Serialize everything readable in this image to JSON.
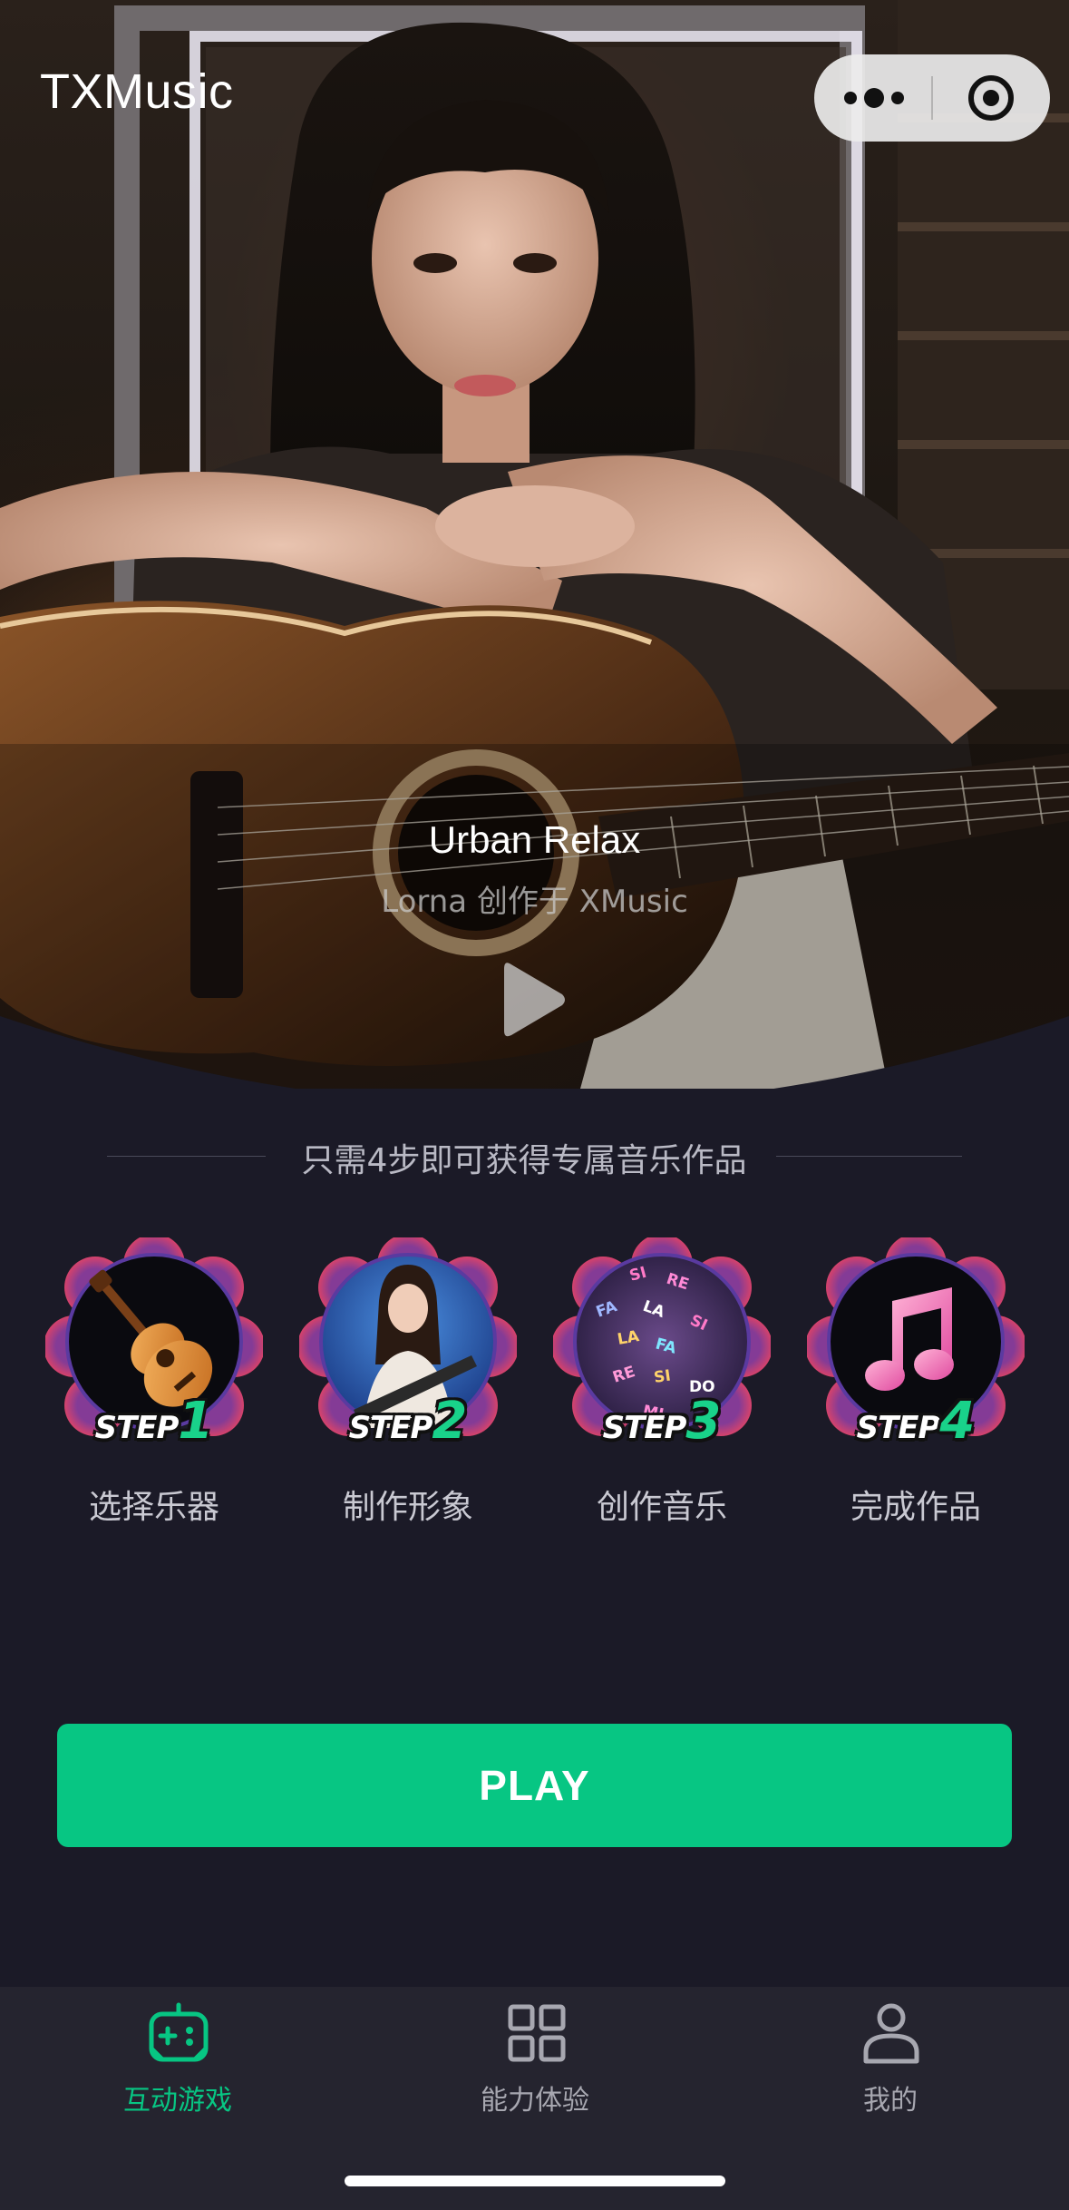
{
  "app": {
    "title": "TXMusic"
  },
  "capsule": {
    "more_icon": "ellipsis-icon",
    "close_icon": "target-circle-icon"
  },
  "hero": {
    "song_title": "Urban Relax",
    "song_subtitle": "Lorna 创作于 XMusic",
    "play_icon": "play-triangle-icon"
  },
  "steps_section": {
    "heading": "只需4步即可获得专属音乐作品",
    "steps": [
      {
        "tag_word": "STEP",
        "tag_num": "1",
        "label": "选择乐器",
        "icon": "ukulele-icon"
      },
      {
        "tag_word": "STEP",
        "tag_num": "2",
        "label": "制作形象",
        "icon": "singer-avatar-icon"
      },
      {
        "tag_word": "STEP",
        "tag_num": "3",
        "label": "创作音乐",
        "icon": "solfege-notes-icon"
      },
      {
        "tag_word": "STEP",
        "tag_num": "4",
        "label": "完成作品",
        "icon": "music-note-icon"
      }
    ]
  },
  "cta": {
    "play_label": "PLAY"
  },
  "tabbar": {
    "tabs": [
      {
        "label": "互动游戏",
        "icon": "gamepad-icon",
        "active": true
      },
      {
        "label": "能力体验",
        "icon": "grid-icon",
        "active": false
      },
      {
        "label": "我的",
        "icon": "user-icon",
        "active": false
      }
    ]
  },
  "colors": {
    "accent": "#07c683",
    "background": "#1b1a27",
    "tabbar": "#25242f"
  }
}
